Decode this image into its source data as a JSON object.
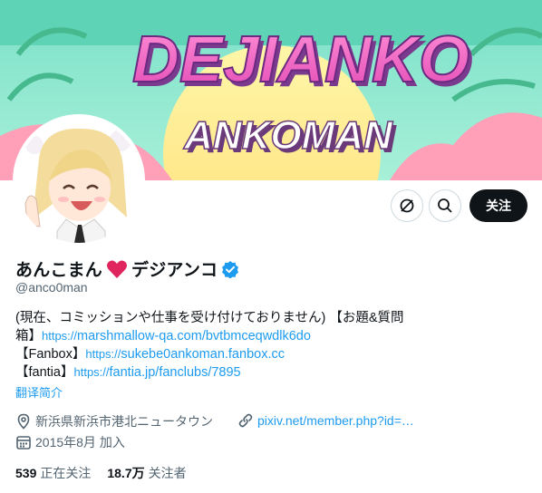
{
  "banner": {
    "title": "DEJIANKO",
    "subtitle": "ANKOMAN"
  },
  "actions": {
    "follow_label": "关注"
  },
  "profile": {
    "name_part1": "あんこまん",
    "name_part2": "デジアンコ",
    "handle": "@anco0man"
  },
  "bio": {
    "line1": "(現在、コミッションや仕事を受け付けておりません) 【お題&質問",
    "line2_prefix": "箱】",
    "marshmallow_prefix": "https://",
    "marshmallow_link": "marshmallow-qa.com/bvtbmceqwdlk6do",
    "fanbox_label": "【Fanbox】",
    "fanbox_prefix": "https://",
    "fanbox_link": "sukebe0ankoman.fanbox.cc",
    "fantia_label": "【fantia】",
    "fantia_prefix": "https://",
    "fantia_link": "fantia.jp/fanclubs/7895",
    "translate": "翻译简介"
  },
  "meta": {
    "location": "新浜県新浜市港北ニュータウン",
    "website": "pixiv.net/member.php?id=…",
    "joined": "2015年8月 加入"
  },
  "stats": {
    "following_count": "539",
    "following_label": "正在关注",
    "followers_count": "18.7万",
    "followers_label": "关注者"
  },
  "colors": {
    "accent": "#1d9bf0",
    "text": "#0f1419",
    "muted": "#536471",
    "heart": "#e0245e"
  }
}
